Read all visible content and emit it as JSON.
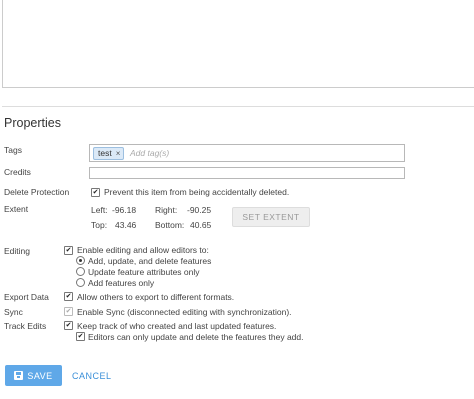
{
  "section_title": "Properties",
  "tags": {
    "label": "Tags",
    "items": [
      "test"
    ],
    "remove_glyph": "×",
    "placeholder": "Add tag(s)"
  },
  "credits": {
    "label": "Credits",
    "value": ""
  },
  "delete_protection": {
    "label": "Delete Protection",
    "checkbox_label": "Prevent this item from being accidentally deleted.",
    "checked": true
  },
  "extent": {
    "label": "Extent",
    "left_label": "Left:",
    "left_value": "-96.18",
    "right_label": "Right:",
    "right_value": "-90.25",
    "top_label": "Top:",
    "top_value": "43.46",
    "bottom_label": "Bottom:",
    "bottom_value": "40.65",
    "set_button": "SET EXTENT"
  },
  "editing": {
    "label": "Editing",
    "enable_label": "Enable editing and allow editors to:",
    "enable_checked": true,
    "options": [
      {
        "label": "Add, update, and delete features",
        "selected": true
      },
      {
        "label": "Update feature attributes only",
        "selected": false
      },
      {
        "label": "Add features only",
        "selected": false
      }
    ]
  },
  "export_data": {
    "label": "Export Data",
    "checkbox_label": "Allow others to export to different formats.",
    "checked": true
  },
  "sync": {
    "label": "Sync",
    "checkbox_label": "Enable Sync (disconnected editing with synchronization).",
    "checked": true,
    "disabled": true
  },
  "track_edits": {
    "label": "Track Edits",
    "checkbox_label": "Keep track of who created and last updated features.",
    "checked": true,
    "sub_label": "Editors can only update and delete the features they add.",
    "sub_checked": true
  },
  "footer": {
    "save_label": "SAVE",
    "cancel_label": "CANCEL"
  },
  "colors": {
    "accent": "#5fa8e8",
    "link": "#3a8fd8",
    "chip_bg": "#dbe9f7"
  },
  "icons": {
    "save": "floppy-disk-icon",
    "remove_tag": "close-icon"
  }
}
